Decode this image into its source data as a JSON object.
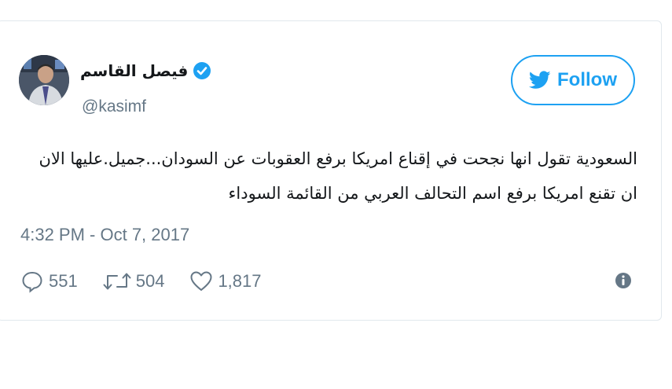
{
  "user": {
    "display_name": "فيصل القاسم",
    "handle": "@kasimf",
    "verified": true
  },
  "follow_button": {
    "label": "Follow",
    "color": "#1da1f2"
  },
  "tweet": {
    "lines": [
      "السعودية تقول انها نجحت في إقناع امريكا برفع العقوبات عن السودان...جميل.عليها الان",
      "ان تقنع امريكا برفع اسم التحالف العربي من القائمة السوداء"
    ],
    "timestamp": "4:32 PM - Oct 7, 2017"
  },
  "stats": {
    "replies": "551",
    "retweets": "504",
    "likes": "1,817"
  },
  "icons": [
    "verified-badge-icon",
    "twitter-bird-icon",
    "reply-icon",
    "retweet-icon",
    "like-icon",
    "info-icon"
  ]
}
